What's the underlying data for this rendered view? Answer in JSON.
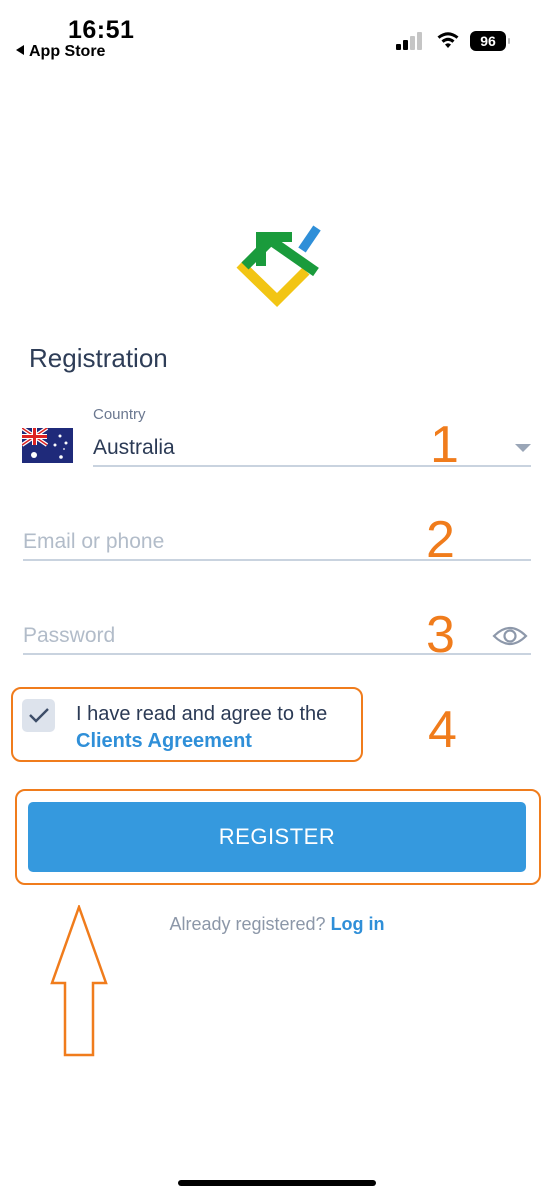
{
  "status_bar": {
    "time": "16:51",
    "back_label": "App Store",
    "battery": "96"
  },
  "page": {
    "title": "Registration"
  },
  "country": {
    "label": "Country",
    "value": "Australia",
    "flag_icon": "australia-flag-icon"
  },
  "email": {
    "placeholder": "Email or phone"
  },
  "password": {
    "placeholder": "Password"
  },
  "agreement": {
    "text": "I have read and agree to the",
    "link": "Clients Agreement",
    "checked": true
  },
  "register": {
    "label": "REGISTER"
  },
  "login": {
    "prompt": "Already registered?",
    "link": "Log in"
  },
  "annotations": {
    "n1": "1",
    "n2": "2",
    "n3": "3",
    "n4": "4",
    "color": "#f07c1c"
  },
  "colors": {
    "accent": "#3599de",
    "link": "#2f8fd8"
  }
}
